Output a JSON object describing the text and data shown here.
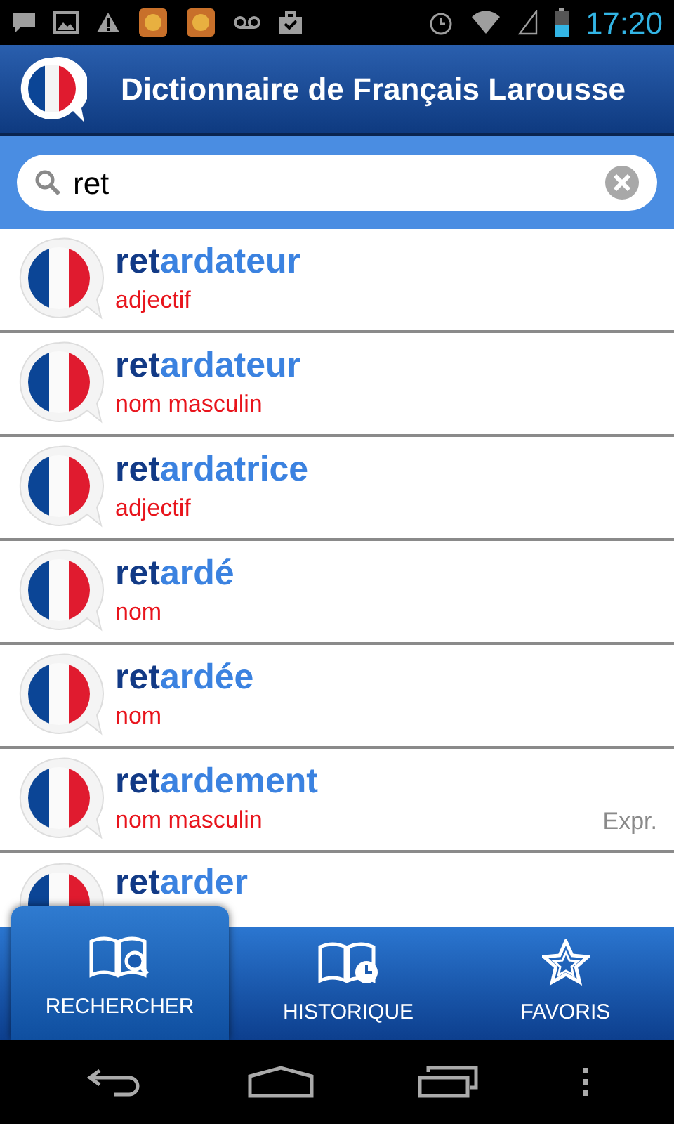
{
  "status_bar": {
    "time": "17:20"
  },
  "header": {
    "title": "Dictionnaire de Français Larousse"
  },
  "search": {
    "value": "ret"
  },
  "results": [
    {
      "match": "ret",
      "rest": "ardateur",
      "pos": "adjectif"
    },
    {
      "match": "ret",
      "rest": "ardateur",
      "pos": "nom masculin"
    },
    {
      "match": "ret",
      "rest": "ardatrice",
      "pos": "adjectif"
    },
    {
      "match": "ret",
      "rest": "ardé",
      "pos": "nom"
    },
    {
      "match": "ret",
      "rest": "ardée",
      "pos": "nom"
    },
    {
      "match": "ret",
      "rest": "ardement",
      "pos": "nom masculin",
      "note": "Expr."
    },
    {
      "match": "ret",
      "rest": "arder"
    }
  ],
  "tabs": [
    {
      "label": "RECHERCHER",
      "kind": "search",
      "selected": true
    },
    {
      "label": "HISTORIQUE",
      "kind": "history",
      "selected": false
    },
    {
      "label": "FAVORIS",
      "kind": "favorites",
      "selected": false
    }
  ]
}
